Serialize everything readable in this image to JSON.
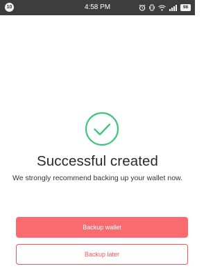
{
  "status_bar": {
    "badge": "10",
    "time": "4:58 PM",
    "battery": "98"
  },
  "result": {
    "title": "Successful created",
    "message": "We strongly recommend backing up your wallet now."
  },
  "actions": {
    "primary_label": "Backup wallet",
    "secondary_label": "Backup later"
  },
  "colors": {
    "accent_green": "#3ec57c",
    "primary_red": "#fa6b6f",
    "status_bar": "#3d3d3d"
  }
}
